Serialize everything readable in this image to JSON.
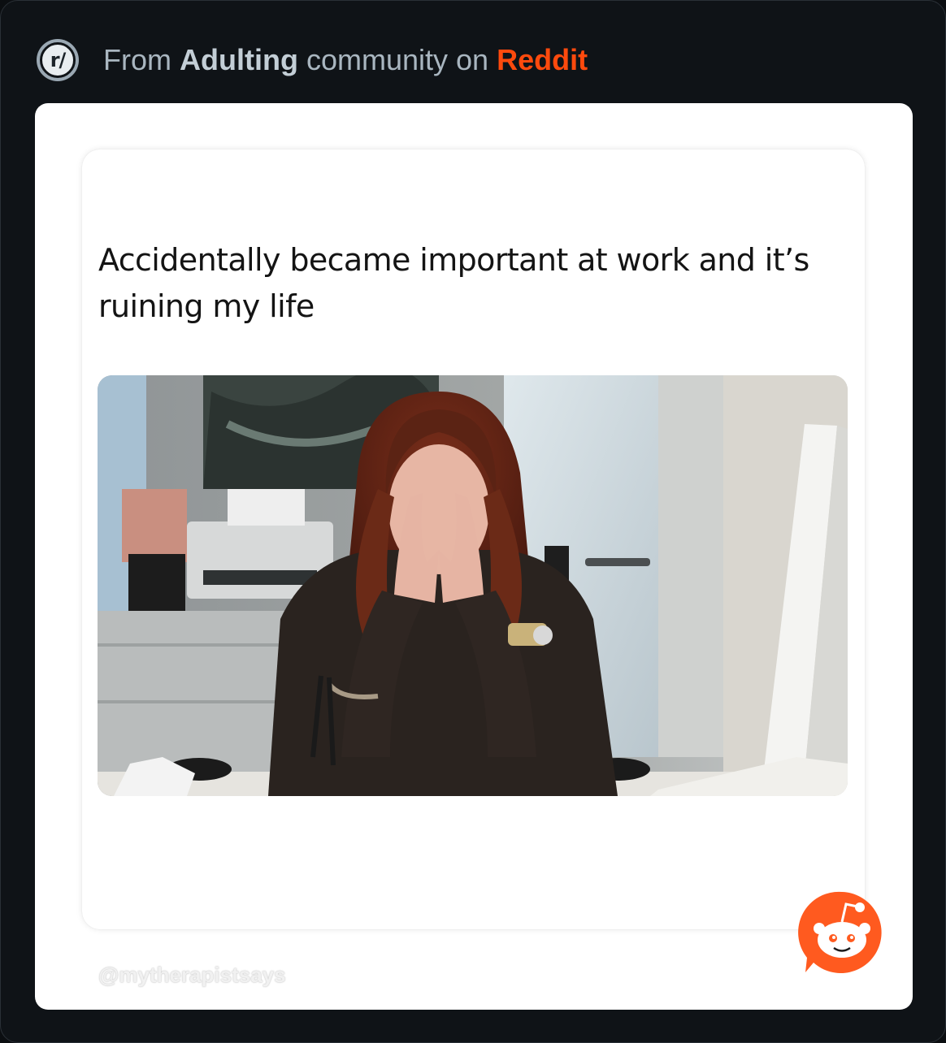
{
  "header": {
    "badge_label": "r/",
    "prefix": "From",
    "community": "Adulting",
    "middle": "community on",
    "brand": "Reddit",
    "brand_color": "#ff4a0d"
  },
  "post": {
    "text": "Accidentally became important at work and it’s ruining my life",
    "image_icon": "photo-of-stressed-woman-at-desk"
  },
  "watermark": "@mytherapistsays",
  "reddit_logo_icon": "reddit-snoo-icon"
}
